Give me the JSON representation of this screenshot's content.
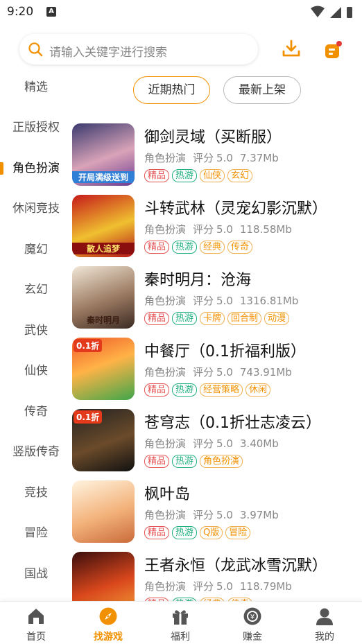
{
  "status": {
    "time": "9:20",
    "app_badge": "A"
  },
  "search": {
    "placeholder": "请输入关键字进行搜索"
  },
  "sidebar": {
    "items": [
      {
        "label": "精选"
      },
      {
        "label": "正版授权"
      },
      {
        "label": "角色扮演"
      },
      {
        "label": "休闲竞技"
      },
      {
        "label": "魔幻"
      },
      {
        "label": "玄幻"
      },
      {
        "label": "武侠"
      },
      {
        "label": "仙侠"
      },
      {
        "label": "传奇"
      },
      {
        "label": "竖版传奇"
      },
      {
        "label": "竞技"
      },
      {
        "label": "冒险"
      },
      {
        "label": "国战"
      }
    ],
    "active_index": 2
  },
  "tabs": {
    "hot": "近期热门",
    "new": "最新上架"
  },
  "rating_prefix": "评分",
  "games": [
    {
      "title": "御剑灵域（买断服）",
      "category": "角色扮演",
      "rating": "5.0",
      "size": "7.37Mb",
      "icon_text": "开局满级送到",
      "tags": [
        {
          "label": "精品",
          "color": "red"
        },
        {
          "label": "热游",
          "color": "green"
        },
        {
          "label": "仙侠",
          "color": "orange"
        },
        {
          "label": "玄幻",
          "color": "orange"
        }
      ]
    },
    {
      "title": "斗转武林（灵宠幻影沉默）",
      "category": "角色扮演",
      "rating": "5.0",
      "size": "118.58Mb",
      "icon_text": "散人追梦",
      "tags": [
        {
          "label": "精品",
          "color": "red"
        },
        {
          "label": "热游",
          "color": "green"
        },
        {
          "label": "经典",
          "color": "orange"
        },
        {
          "label": "传奇",
          "color": "orange"
        }
      ]
    },
    {
      "title": "秦时明月：沧海",
      "category": "角色扮演",
      "rating": "5.0",
      "size": "1316.81Mb",
      "icon_text": "秦时明月",
      "tags": [
        {
          "label": "精品",
          "color": "red"
        },
        {
          "label": "热游",
          "color": "green"
        },
        {
          "label": "卡牌",
          "color": "orange"
        },
        {
          "label": "回合制",
          "color": "orange"
        },
        {
          "label": "动漫",
          "color": "orange"
        }
      ]
    },
    {
      "title": "中餐厅（0.1折福利版）",
      "category": "角色扮演",
      "rating": "5.0",
      "size": "743.91Mb",
      "icon_text": "0.1折",
      "tags": [
        {
          "label": "精品",
          "color": "red"
        },
        {
          "label": "热游",
          "color": "green"
        },
        {
          "label": "经营策略",
          "color": "orange"
        },
        {
          "label": "休闲",
          "color": "orange"
        }
      ]
    },
    {
      "title": "苍穹志（0.1折壮志凌云）",
      "category": "角色扮演",
      "rating": "5.0",
      "size": "3.40Mb",
      "icon_text": "0.1折",
      "tags": [
        {
          "label": "精品",
          "color": "red"
        },
        {
          "label": "热游",
          "color": "green"
        },
        {
          "label": "角色扮演",
          "color": "orange"
        }
      ]
    },
    {
      "title": "枫叶岛",
      "category": "角色扮演",
      "rating": "5.0",
      "size": "3.97Mb",
      "icon_text": "",
      "tags": [
        {
          "label": "精品",
          "color": "red"
        },
        {
          "label": "热游",
          "color": "green"
        },
        {
          "label": "Q版",
          "color": "orange"
        },
        {
          "label": "冒险",
          "color": "orange"
        }
      ]
    },
    {
      "title": "王者永恒（龙武冰雪沉默）",
      "category": "角色扮演",
      "rating": "5.0",
      "size": "118.79Mb",
      "icon_text": "",
      "tags": [
        {
          "label": "精品",
          "color": "red"
        },
        {
          "label": "热游",
          "color": "green"
        },
        {
          "label": "经典",
          "color": "orange"
        },
        {
          "label": "传奇",
          "color": "orange"
        }
      ]
    }
  ],
  "bottom_nav": [
    {
      "label": "首页",
      "icon": "home-icon"
    },
    {
      "label": "找游戏",
      "icon": "compass-icon"
    },
    {
      "label": "福利",
      "icon": "gift-icon"
    },
    {
      "label": "赚金",
      "icon": "coin-icon"
    },
    {
      "label": "我的",
      "icon": "profile-icon"
    }
  ],
  "colors": {
    "accent": "#f29100",
    "tag_red": "#e65555",
    "tag_green": "#1fb07e",
    "tag_orange": "#f0b050"
  }
}
